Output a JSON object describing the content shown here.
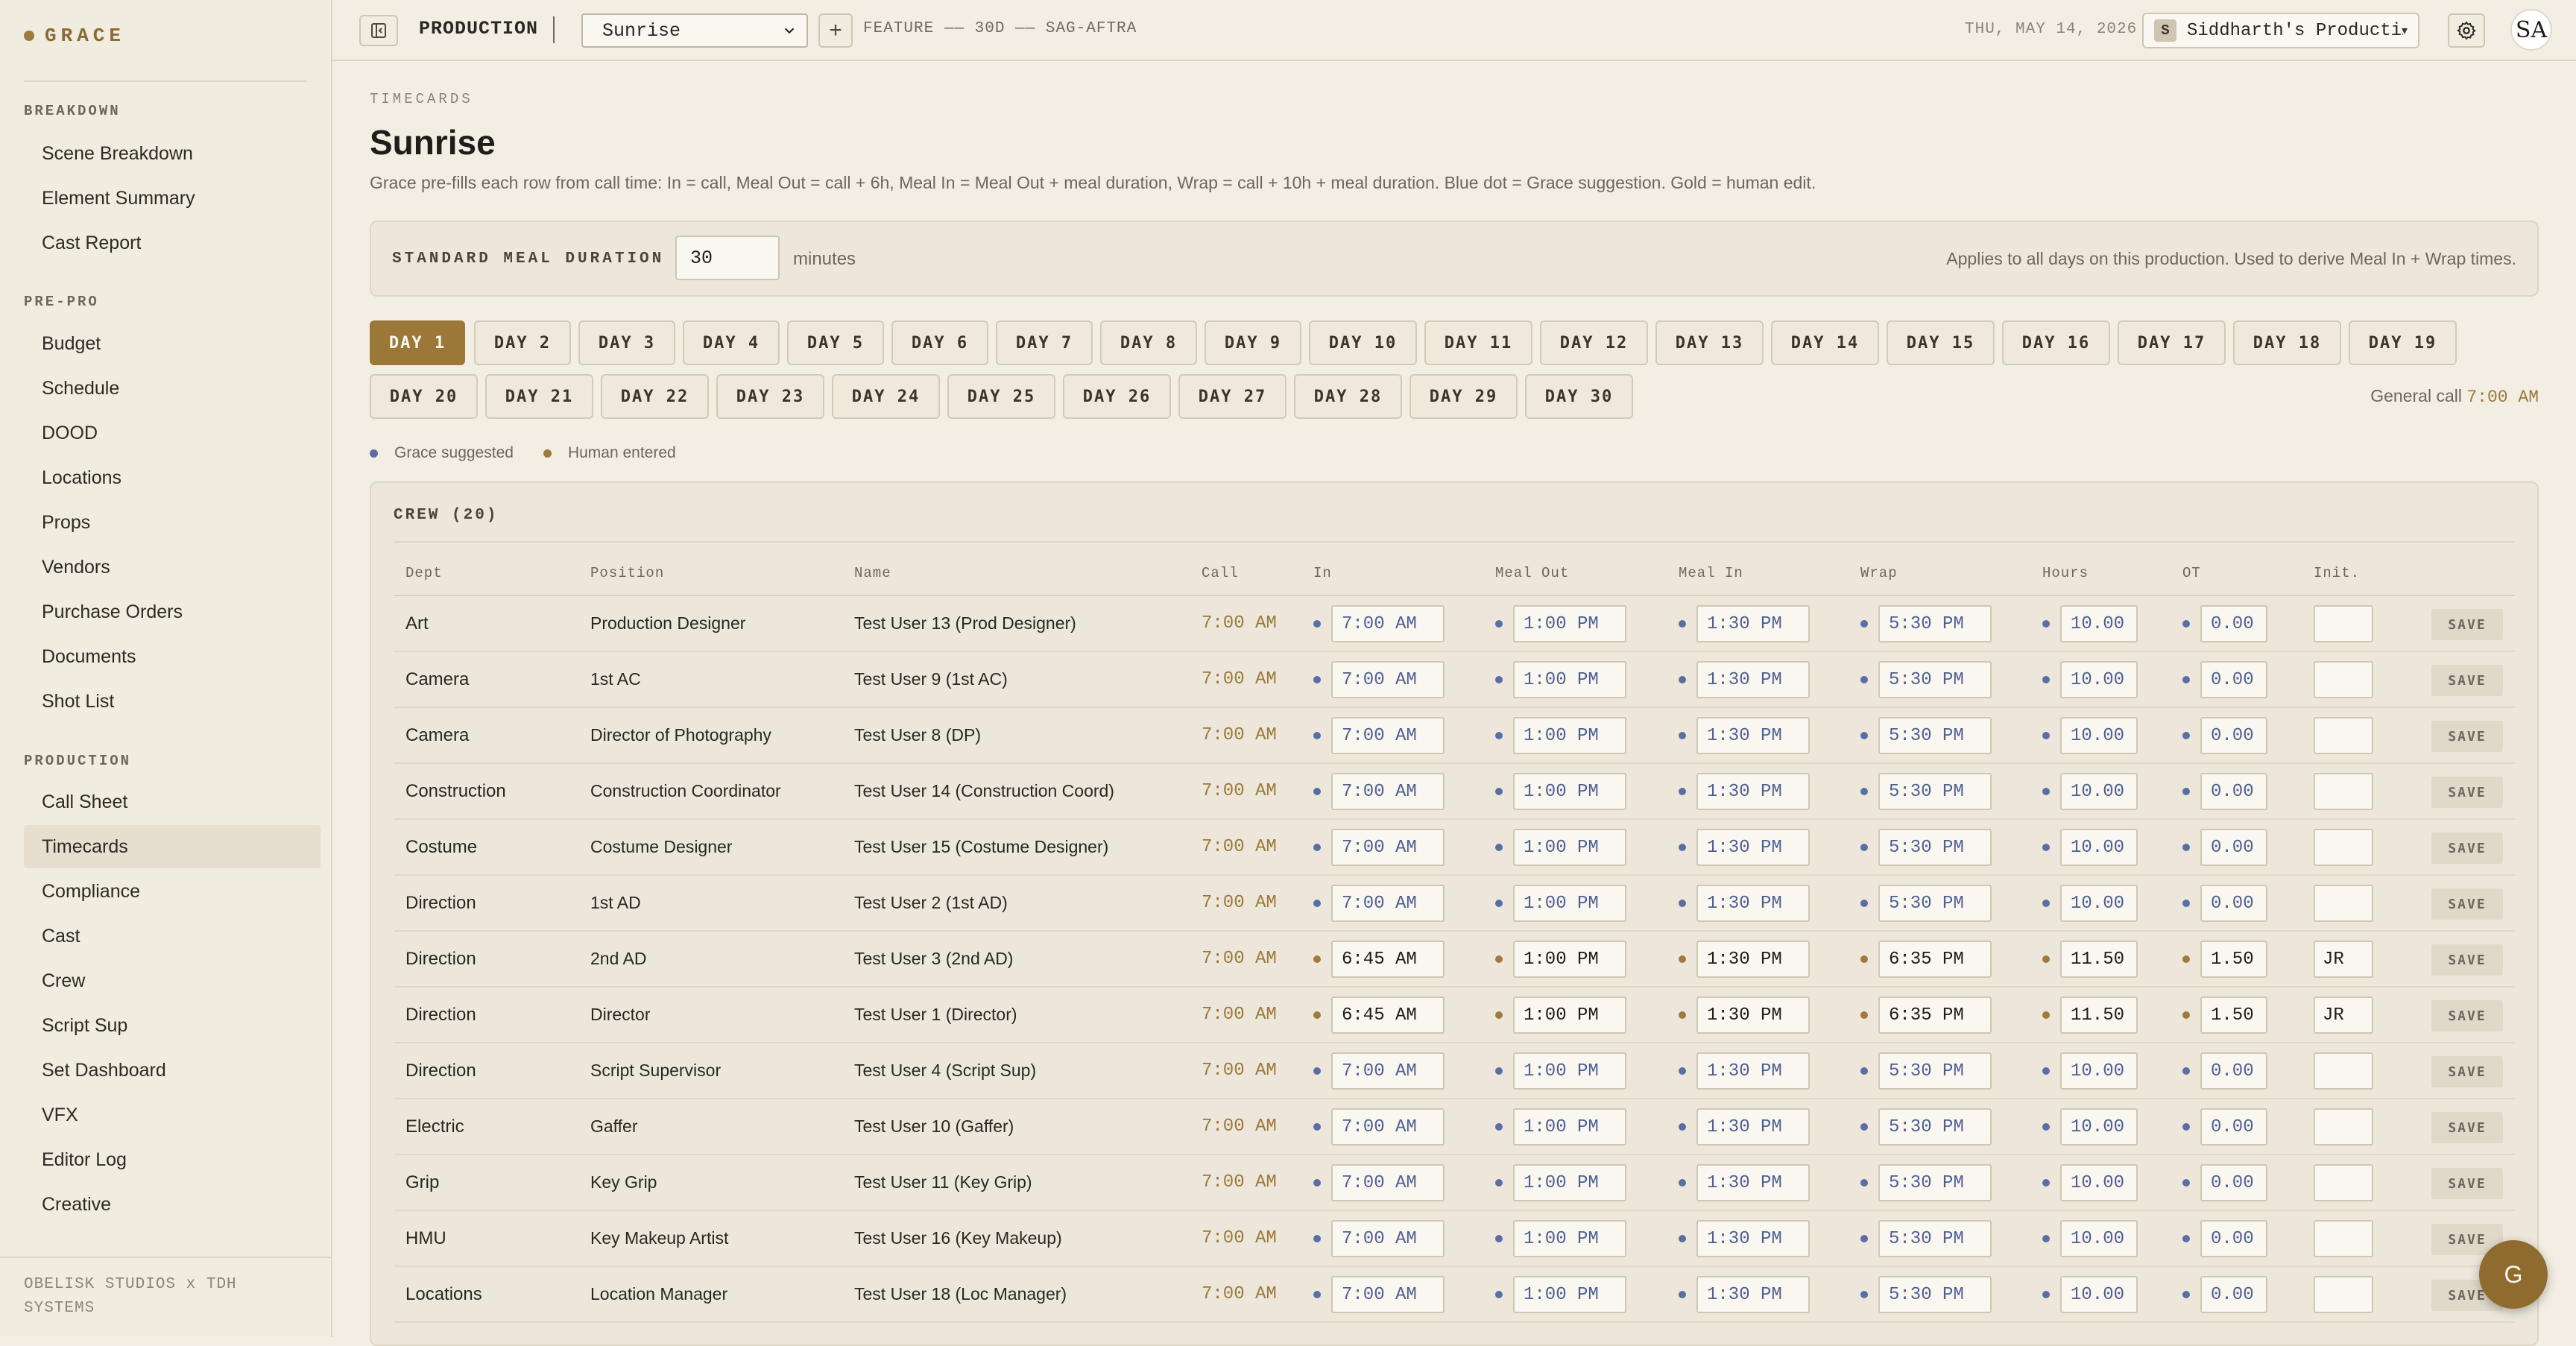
{
  "brand": {
    "name": "GRACE"
  },
  "sidebar": {
    "sections": [
      {
        "label": "BREAKDOWN",
        "items": [
          "Scene Breakdown",
          "Element Summary",
          "Cast Report"
        ]
      },
      {
        "label": "PRE-PRO",
        "items": [
          "Budget",
          "Schedule",
          "DOOD",
          "Locations",
          "Props",
          "Vendors",
          "Purchase Orders",
          "Documents",
          "Shot List"
        ]
      },
      {
        "label": "PRODUCTION",
        "items": [
          "Call Sheet",
          "Timecards",
          "Compliance",
          "Cast",
          "Crew",
          "Script Sup",
          "Set Dashboard",
          "VFX",
          "Editor Log",
          "Creative"
        ]
      }
    ],
    "active_item": "Timecards",
    "footer": "OBELISK STUDIOS x TDH SYSTEMS"
  },
  "topbar": {
    "section_label": "PRODUCTION",
    "project": "Sunrise",
    "project_meta": "FEATURE —— 30D —— SAG-AFTRA",
    "date": "THU, MAY 14, 2026",
    "company_badge": "S",
    "company_name": "Siddharth's Producti…",
    "avatar_initials": "SA"
  },
  "page": {
    "eyebrow": "TIMECARDS",
    "title": "Sunrise",
    "description": "Grace pre-fills each row from call time: In = call, Meal Out = call + 6h, Meal In = Meal Out + meal duration, Wrap = call + 10h + meal duration. Blue dot = Grace suggestion. Gold = human edit."
  },
  "meal": {
    "label": "STANDARD MEAL DURATION",
    "value": "30",
    "unit": "minutes",
    "note": "Applies to all days on this production. Used to derive Meal In + Wrap times."
  },
  "days": [
    "DAY 1",
    "DAY 2",
    "DAY 3",
    "DAY 4",
    "DAY 5",
    "DAY 6",
    "DAY 7",
    "DAY 8",
    "DAY 9",
    "DAY 10",
    "DAY 11",
    "DAY 12",
    "DAY 13",
    "DAY 14",
    "DAY 15",
    "DAY 16",
    "DAY 17",
    "DAY 18",
    "DAY 19",
    "DAY 20",
    "DAY 21",
    "DAY 22",
    "DAY 23",
    "DAY 24",
    "DAY 25",
    "DAY 26",
    "DAY 27",
    "DAY 28",
    "DAY 29",
    "DAY 30"
  ],
  "active_day": "DAY 1",
  "general_call": {
    "label": "General call",
    "time": "7:00 AM"
  },
  "legend": {
    "grace": "Grace suggested",
    "human": "Human entered"
  },
  "colors": {
    "accent": "#9b7838",
    "grace_dot": "#5a6ea6",
    "human_dot": "#a07a3a",
    "background": "#f3eee3"
  },
  "crew": {
    "title": "CREW (20)",
    "columns": [
      "Dept",
      "Position",
      "Name",
      "Call",
      "In",
      "Meal Out",
      "Meal In",
      "Wrap",
      "Hours",
      "OT",
      "Init."
    ],
    "save_label": "SAVE",
    "rows": [
      {
        "dept": "Art",
        "position": "Production Designer",
        "name": "Test User 13 (Prod Designer)",
        "call": "7:00 AM",
        "in": "7:00 AM",
        "meal_out": "1:00 PM",
        "meal_in": "1:30 PM",
        "wrap": "5:30 PM",
        "hours": "10.00",
        "ot": "0.00",
        "init": "",
        "source": "grace"
      },
      {
        "dept": "Camera",
        "position": "1st AC",
        "name": "Test User 9 (1st AC)",
        "call": "7:00 AM",
        "in": "7:00 AM",
        "meal_out": "1:00 PM",
        "meal_in": "1:30 PM",
        "wrap": "5:30 PM",
        "hours": "10.00",
        "ot": "0.00",
        "init": "",
        "source": "grace"
      },
      {
        "dept": "Camera",
        "position": "Director of Photography",
        "name": "Test User 8 (DP)",
        "call": "7:00 AM",
        "in": "7:00 AM",
        "meal_out": "1:00 PM",
        "meal_in": "1:30 PM",
        "wrap": "5:30 PM",
        "hours": "10.00",
        "ot": "0.00",
        "init": "",
        "source": "grace"
      },
      {
        "dept": "Construction",
        "position": "Construction Coordinator",
        "name": "Test User 14 (Construction Coord)",
        "call": "7:00 AM",
        "in": "7:00 AM",
        "meal_out": "1:00 PM",
        "meal_in": "1:30 PM",
        "wrap": "5:30 PM",
        "hours": "10.00",
        "ot": "0.00",
        "init": "",
        "source": "grace"
      },
      {
        "dept": "Costume",
        "position": "Costume Designer",
        "name": "Test User 15 (Costume Designer)",
        "call": "7:00 AM",
        "in": "7:00 AM",
        "meal_out": "1:00 PM",
        "meal_in": "1:30 PM",
        "wrap": "5:30 PM",
        "hours": "10.00",
        "ot": "0.00",
        "init": "",
        "source": "grace"
      },
      {
        "dept": "Direction",
        "position": "1st AD",
        "name": "Test User 2 (1st AD)",
        "call": "7:00 AM",
        "in": "7:00 AM",
        "meal_out": "1:00 PM",
        "meal_in": "1:30 PM",
        "wrap": "5:30 PM",
        "hours": "10.00",
        "ot": "0.00",
        "init": "",
        "source": "grace"
      },
      {
        "dept": "Direction",
        "position": "2nd AD",
        "name": "Test User 3 (2nd AD)",
        "call": "7:00 AM",
        "in": "6:45 AM",
        "meal_out": "1:00 PM",
        "meal_in": "1:30 PM",
        "wrap": "6:35 PM",
        "hours": "11.50",
        "ot": "1.50",
        "init": "JR",
        "source": "human"
      },
      {
        "dept": "Direction",
        "position": "Director",
        "name": "Test User 1 (Director)",
        "call": "7:00 AM",
        "in": "6:45 AM",
        "meal_out": "1:00 PM",
        "meal_in": "1:30 PM",
        "wrap": "6:35 PM",
        "hours": "11.50",
        "ot": "1.50",
        "init": "JR",
        "source": "human"
      },
      {
        "dept": "Direction",
        "position": "Script Supervisor",
        "name": "Test User 4 (Script Sup)",
        "call": "7:00 AM",
        "in": "7:00 AM",
        "meal_out": "1:00 PM",
        "meal_in": "1:30 PM",
        "wrap": "5:30 PM",
        "hours": "10.00",
        "ot": "0.00",
        "init": "",
        "source": "grace"
      },
      {
        "dept": "Electric",
        "position": "Gaffer",
        "name": "Test User 10 (Gaffer)",
        "call": "7:00 AM",
        "in": "7:00 AM",
        "meal_out": "1:00 PM",
        "meal_in": "1:30 PM",
        "wrap": "5:30 PM",
        "hours": "10.00",
        "ot": "0.00",
        "init": "",
        "source": "grace"
      },
      {
        "dept": "Grip",
        "position": "Key Grip",
        "name": "Test User 11 (Key Grip)",
        "call": "7:00 AM",
        "in": "7:00 AM",
        "meal_out": "1:00 PM",
        "meal_in": "1:30 PM",
        "wrap": "5:30 PM",
        "hours": "10.00",
        "ot": "0.00",
        "init": "",
        "source": "grace"
      },
      {
        "dept": "HMU",
        "position": "Key Makeup Artist",
        "name": "Test User 16 (Key Makeup)",
        "call": "7:00 AM",
        "in": "7:00 AM",
        "meal_out": "1:00 PM",
        "meal_in": "1:30 PM",
        "wrap": "5:30 PM",
        "hours": "10.00",
        "ot": "0.00",
        "init": "",
        "source": "grace"
      },
      {
        "dept": "Locations",
        "position": "Location Manager",
        "name": "Test User 18 (Loc Manager)",
        "call": "7:00 AM",
        "in": "7:00 AM",
        "meal_out": "1:00 PM",
        "meal_in": "1:30 PM",
        "wrap": "5:30 PM",
        "hours": "10.00",
        "ot": "0.00",
        "init": "",
        "source": "grace"
      }
    ]
  },
  "fab": {
    "label": "G"
  }
}
